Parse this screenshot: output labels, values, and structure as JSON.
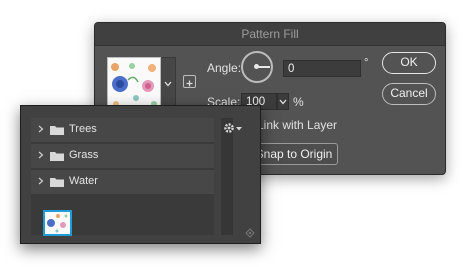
{
  "dialog": {
    "title": "Pattern Fill",
    "angle_label": "Angle:",
    "angle_value": "0",
    "degree_symbol": "°",
    "scale_label": "Scale:",
    "scale_value": "100",
    "percent_symbol": "%",
    "link_with_layer_label": "Link with Layer",
    "snap_to_origin_label": "Snap to Origin",
    "ok_label": "OK",
    "cancel_label": "Cancel"
  },
  "picker": {
    "groups": [
      {
        "label": "Trees"
      },
      {
        "label": "Grass"
      },
      {
        "label": "Water"
      }
    ]
  },
  "icons": {
    "dropdown": "chevron-down-icon",
    "folder": "folder-icon",
    "expand": "chevron-right-icon",
    "settings": "gear-icon",
    "resize": "resize-grip-icon"
  },
  "colors": {
    "dialog_bg": "#535353",
    "panel_bg": "#414141",
    "selection": "#1f9bd8"
  }
}
